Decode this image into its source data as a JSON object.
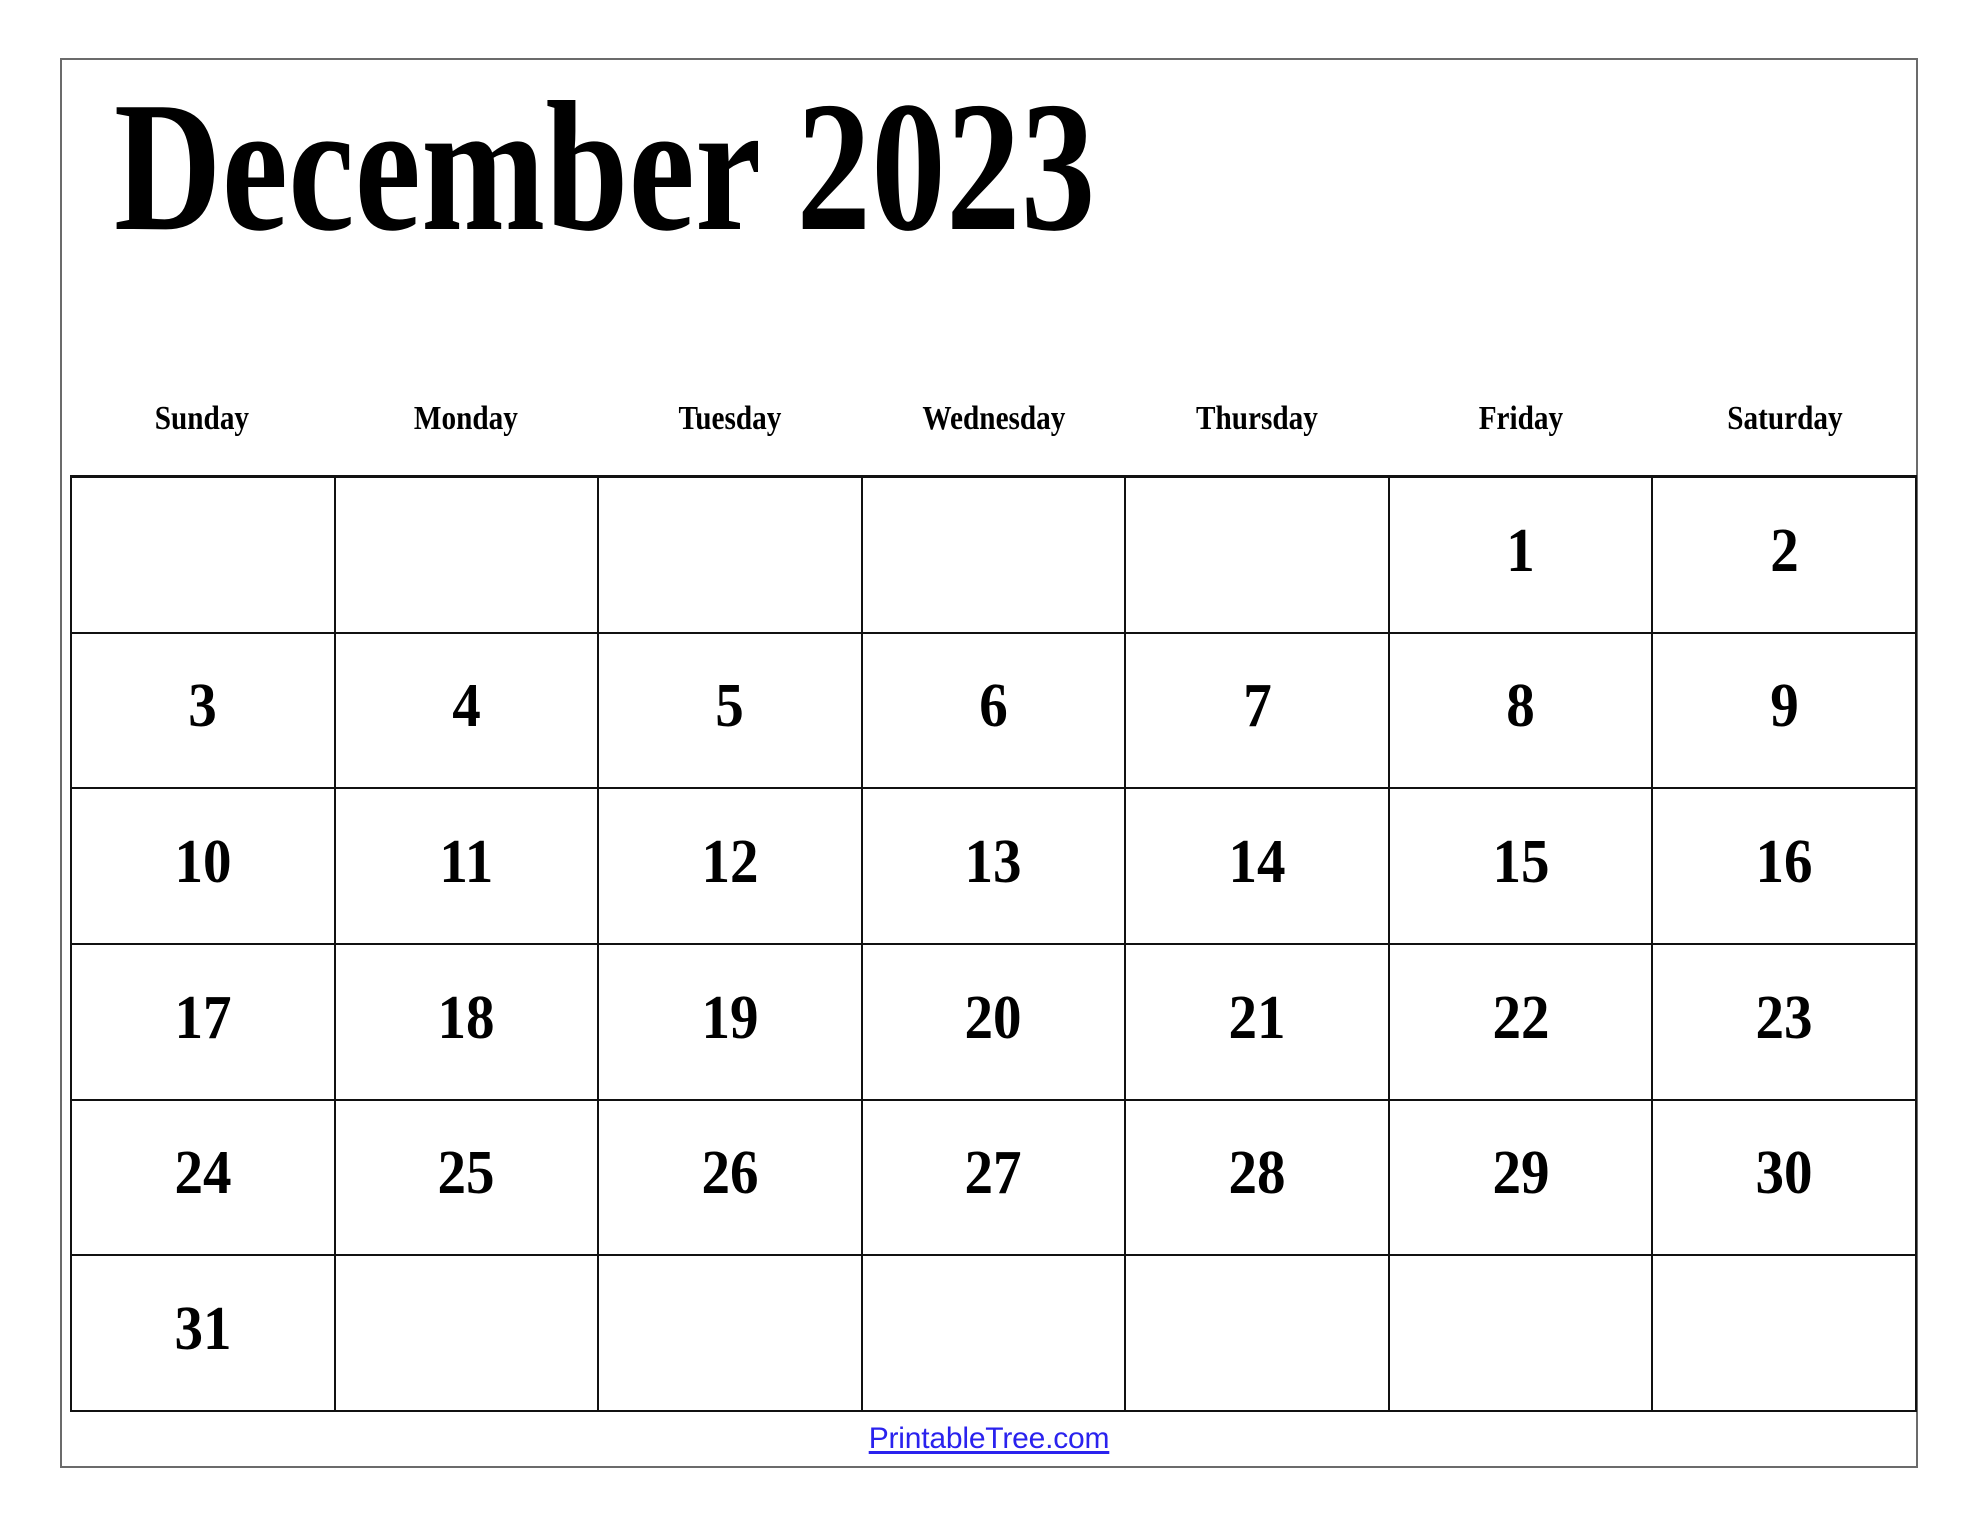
{
  "page": {
    "background_color": "#ffffff",
    "border_color": "#6b6b6b"
  },
  "title": {
    "month": "December",
    "year": "2023",
    "full": "December 2023",
    "color": "#000000"
  },
  "weekdays": [
    {
      "label": "Sunday"
    },
    {
      "label": "Monday"
    },
    {
      "label": "Tuesday"
    },
    {
      "label": "Wednesday"
    },
    {
      "label": "Thursday"
    },
    {
      "label": "Friday"
    },
    {
      "label": "Saturday"
    }
  ],
  "grid": {
    "columns": 7,
    "rows": 6,
    "border_color": "#111111",
    "weeks": [
      {
        "days": [
          "",
          "",
          "",
          "",
          "",
          "1",
          "2"
        ]
      },
      {
        "days": [
          "3",
          "4",
          "5",
          "6",
          "7",
          "8",
          "9"
        ]
      },
      {
        "days": [
          "10",
          "11",
          "12",
          "13",
          "14",
          "15",
          "16"
        ]
      },
      {
        "days": [
          "17",
          "18",
          "19",
          "20",
          "21",
          "22",
          "23"
        ]
      },
      {
        "days": [
          "24",
          "25",
          "26",
          "27",
          "28",
          "29",
          "30"
        ]
      },
      {
        "days": [
          "31",
          "",
          "",
          "",
          "",
          "",
          ""
        ]
      }
    ]
  },
  "footer": {
    "link_text": "PrintableTree.com",
    "link_color": "#2a22ee"
  }
}
